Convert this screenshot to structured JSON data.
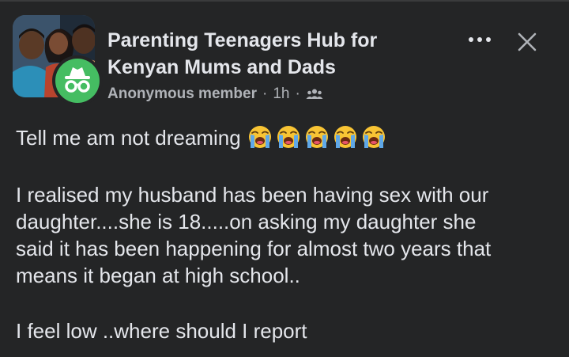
{
  "group": {
    "name_line1": "Parenting Teenagers Hub for",
    "name_line2": "Kenyan Mums and Dads",
    "avatar": "group-photo"
  },
  "post_meta": {
    "author": "Anonymous member",
    "separator": "·",
    "time": "1h",
    "audience_icon": "group-people-icon",
    "author_icon": "incognito-icon"
  },
  "header_actions": {
    "more_icon": "more-dots-icon",
    "close_icon": "close-icon"
  },
  "post_body": {
    "line1": "Tell me am not dreaming",
    "emoji_count": 5,
    "emoji_name": "loudly-crying-face",
    "para2_line1": "I realised my husband has been having sex with our",
    "para2_line2": "daughter....she is 18.....on asking my daughter she",
    "para2_line3": "said it has been happening for almost two years that",
    "para2_line4": "means it began at high school..",
    "para3_line1": "I feel low ..where should I report"
  },
  "colors": {
    "background": "#242526",
    "primary_text": "#e4e6eb",
    "secondary_text": "#b0b3b8",
    "badge_green": "#45bd62"
  }
}
